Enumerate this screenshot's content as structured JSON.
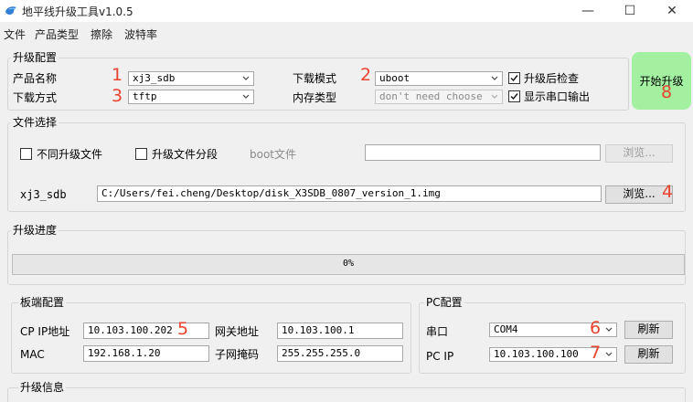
{
  "window": {
    "title": "地平线升级工具v1.0.5",
    "minimize_glyph": "—",
    "maximize_glyph": "☐",
    "close_glyph": "✕"
  },
  "menu": [
    "文件",
    "产品类型",
    "擦除",
    "波特率"
  ],
  "upgrade_config": {
    "title": "升级配置",
    "product_label": "产品名称",
    "product_value": "xj3_sdb",
    "download_mode_label": "下载模式",
    "download_mode_value": "uboot",
    "check_after_label": "升级后检查",
    "download_method_label": "下载方式",
    "download_method_value": "tftp",
    "memory_type_label": "内存类型",
    "memory_type_value": "don't need choose",
    "show_serial_label": "显示串口输出"
  },
  "start_button": {
    "label": "开始升级"
  },
  "file_select": {
    "title": "文件选择",
    "diff_files_label": "不同升级文件",
    "file_segment_label": "升级文件分段",
    "boot_file_label": "boot文件",
    "boot_file_value": "",
    "browse_label": "浏览...",
    "image_label": "xj3_sdb",
    "image_path": "C:/Users/fei.cheng/Desktop/disk_X3SDB_0807_version_1.img"
  },
  "progress": {
    "title": "升级进度",
    "percent": 0,
    "text": "0%"
  },
  "board_config": {
    "title": "板端配置",
    "cp_ip_label": "CP IP地址",
    "cp_ip_value": "10.103.100.202",
    "gateway_label": "网关地址",
    "gateway_value": "10.103.100.1",
    "mac_label": "MAC",
    "mac_value": "192.168.1.20",
    "subnet_label": "子网掩码",
    "subnet_value": "255.255.255.0"
  },
  "pc_config": {
    "title": "PC配置",
    "serial_label": "串口",
    "serial_value": "COM4",
    "refresh_label": "刷新",
    "pc_ip_label": "PC IP",
    "pc_ip_value": "10.103.100.100"
  },
  "upgrade_info": {
    "title": "升级信息"
  },
  "markers": [
    "1",
    "2",
    "3",
    "4",
    "5",
    "6",
    "7",
    "8"
  ],
  "colors": {
    "start_button": "#a2f0a0",
    "marker": "#e8432e"
  }
}
